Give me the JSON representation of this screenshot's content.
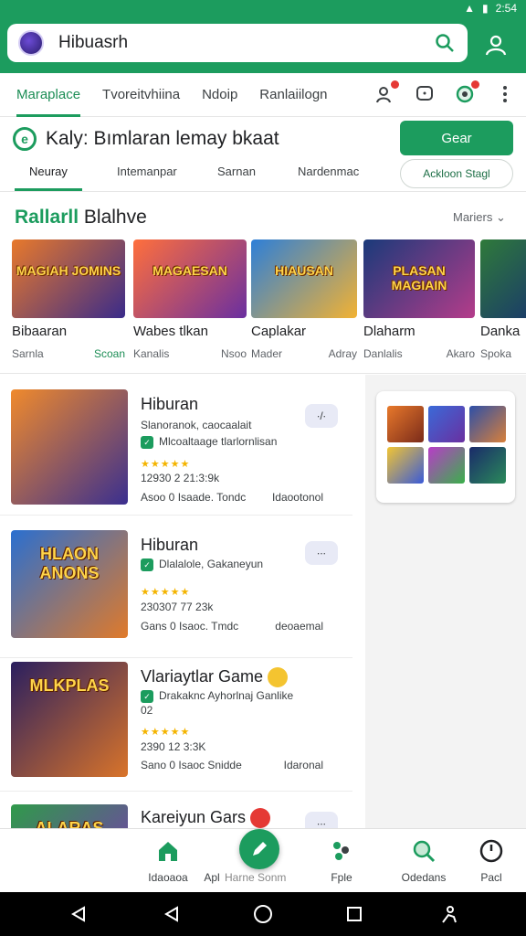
{
  "status": {
    "time": "2:54"
  },
  "search": {
    "value": "Hibuasrh"
  },
  "nav": {
    "tabs": [
      "Maraplace",
      "Tvoreitvhiina",
      "Ndoip",
      "Ranlaiilogn"
    ]
  },
  "banner": {
    "text": "Kaly: Bımlaran lemay bkaat",
    "button": "Gear"
  },
  "subtabs": {
    "items": [
      "Neuray",
      "Intemanpar",
      "Sarnan",
      "Nardenmac"
    ],
    "pill": "Ackloon Stagl"
  },
  "section": {
    "title_green": "Rallarll",
    "title_rest": "Blalhve",
    "more": "Mariers"
  },
  "carousel": [
    {
      "caption": "MAGIAH JOMINS",
      "title": "Bibaaran",
      "sub_left": "Sarnla",
      "sub_right": "Scoan",
      "colors": [
        "#e8792b",
        "#3a2b8a"
      ]
    },
    {
      "caption": "MAGAESAN",
      "title": "Wabes tlkan",
      "sub_left": "Kanalis",
      "sub_right": "Nsoo",
      "colors": [
        "#ff6f3c",
        "#6a2fa0"
      ]
    },
    {
      "caption": "HIAUSAN",
      "title": "Caplakar",
      "sub_left": "Mader",
      "sub_right": "Adray",
      "colors": [
        "#2d7fd8",
        "#f2b233"
      ]
    },
    {
      "caption": "PLASAN MAGIAIN",
      "title": "Dlaharm",
      "sub_left": "Danlalis",
      "sub_right": "Akaro",
      "colors": [
        "#1a3a7a",
        "#b43c8a"
      ]
    },
    {
      "caption": "",
      "title": "Danka",
      "sub_left": "Spoka",
      "sub_right": "",
      "colors": [
        "#2f7a3a",
        "#1a3a6a"
      ]
    }
  ],
  "list": [
    {
      "caption": "",
      "title": "Hiburan",
      "l1": "Slanoranok, caocaalait",
      "l2": "Mlcoaltaage tlarlornlisan",
      "stars": "★★★★★",
      "meta": "12930 2 21:3:9k",
      "foot_left": "Asoo 0 Isaade. Tondc",
      "foot_right": "Idaootonol",
      "more": "∙/∙",
      "colors": [
        "#f08a2c",
        "#3a2f8f"
      ]
    },
    {
      "caption": "HLAON ANONS",
      "title": "Hiburan",
      "l1": "",
      "l2": "Dlalalole, Gakaneyun",
      "stars": "★★★★★",
      "meta": "230307 77 23k",
      "foot_left": "Gans 0 Isaoc. Tmdc",
      "foot_right": "deoaemal",
      "more": "∙∙∙",
      "colors": [
        "#2a6fd0",
        "#e07a2a"
      ]
    },
    {
      "caption": "MLKPLAS",
      "title": "Vlariaytlar Game",
      "l1": "",
      "l2": "Drakaknc Ayhorlnaj Ganlike",
      "l3": "02",
      "stars": "★★★★★",
      "meta": "2390 12 3:3K",
      "foot_left": "Sano 0 Isaoc Snidde",
      "foot_right": "Idaronal",
      "more": "",
      "colors": [
        "#2a1f5f",
        "#d9742a"
      ]
    },
    {
      "caption": "ALARAS",
      "title": "Kareiyun Gars",
      "l1": "",
      "l2": "",
      "stars": "",
      "meta": "",
      "foot_left": "",
      "foot_right": "",
      "more": "∙∙∙",
      "colors": [
        "#2f9a4a",
        "#7a3ab0"
      ]
    }
  ],
  "bottomnav": [
    {
      "label": "Idaoaoa",
      "icon": "home-icon"
    },
    {
      "label": "Apl",
      "icon": "apps-icon"
    },
    {
      "label": "Harne Sonm",
      "icon": "edit-icon"
    },
    {
      "label": "Fple",
      "icon": "people-icon"
    },
    {
      "label": "Odedans",
      "icon": "search-icon"
    },
    {
      "label": "Pacl",
      "icon": "timer-icon"
    }
  ],
  "colors": {
    "primary": "#1c9c5e",
    "accent_red": "#e53935",
    "star": "#f4b400"
  }
}
